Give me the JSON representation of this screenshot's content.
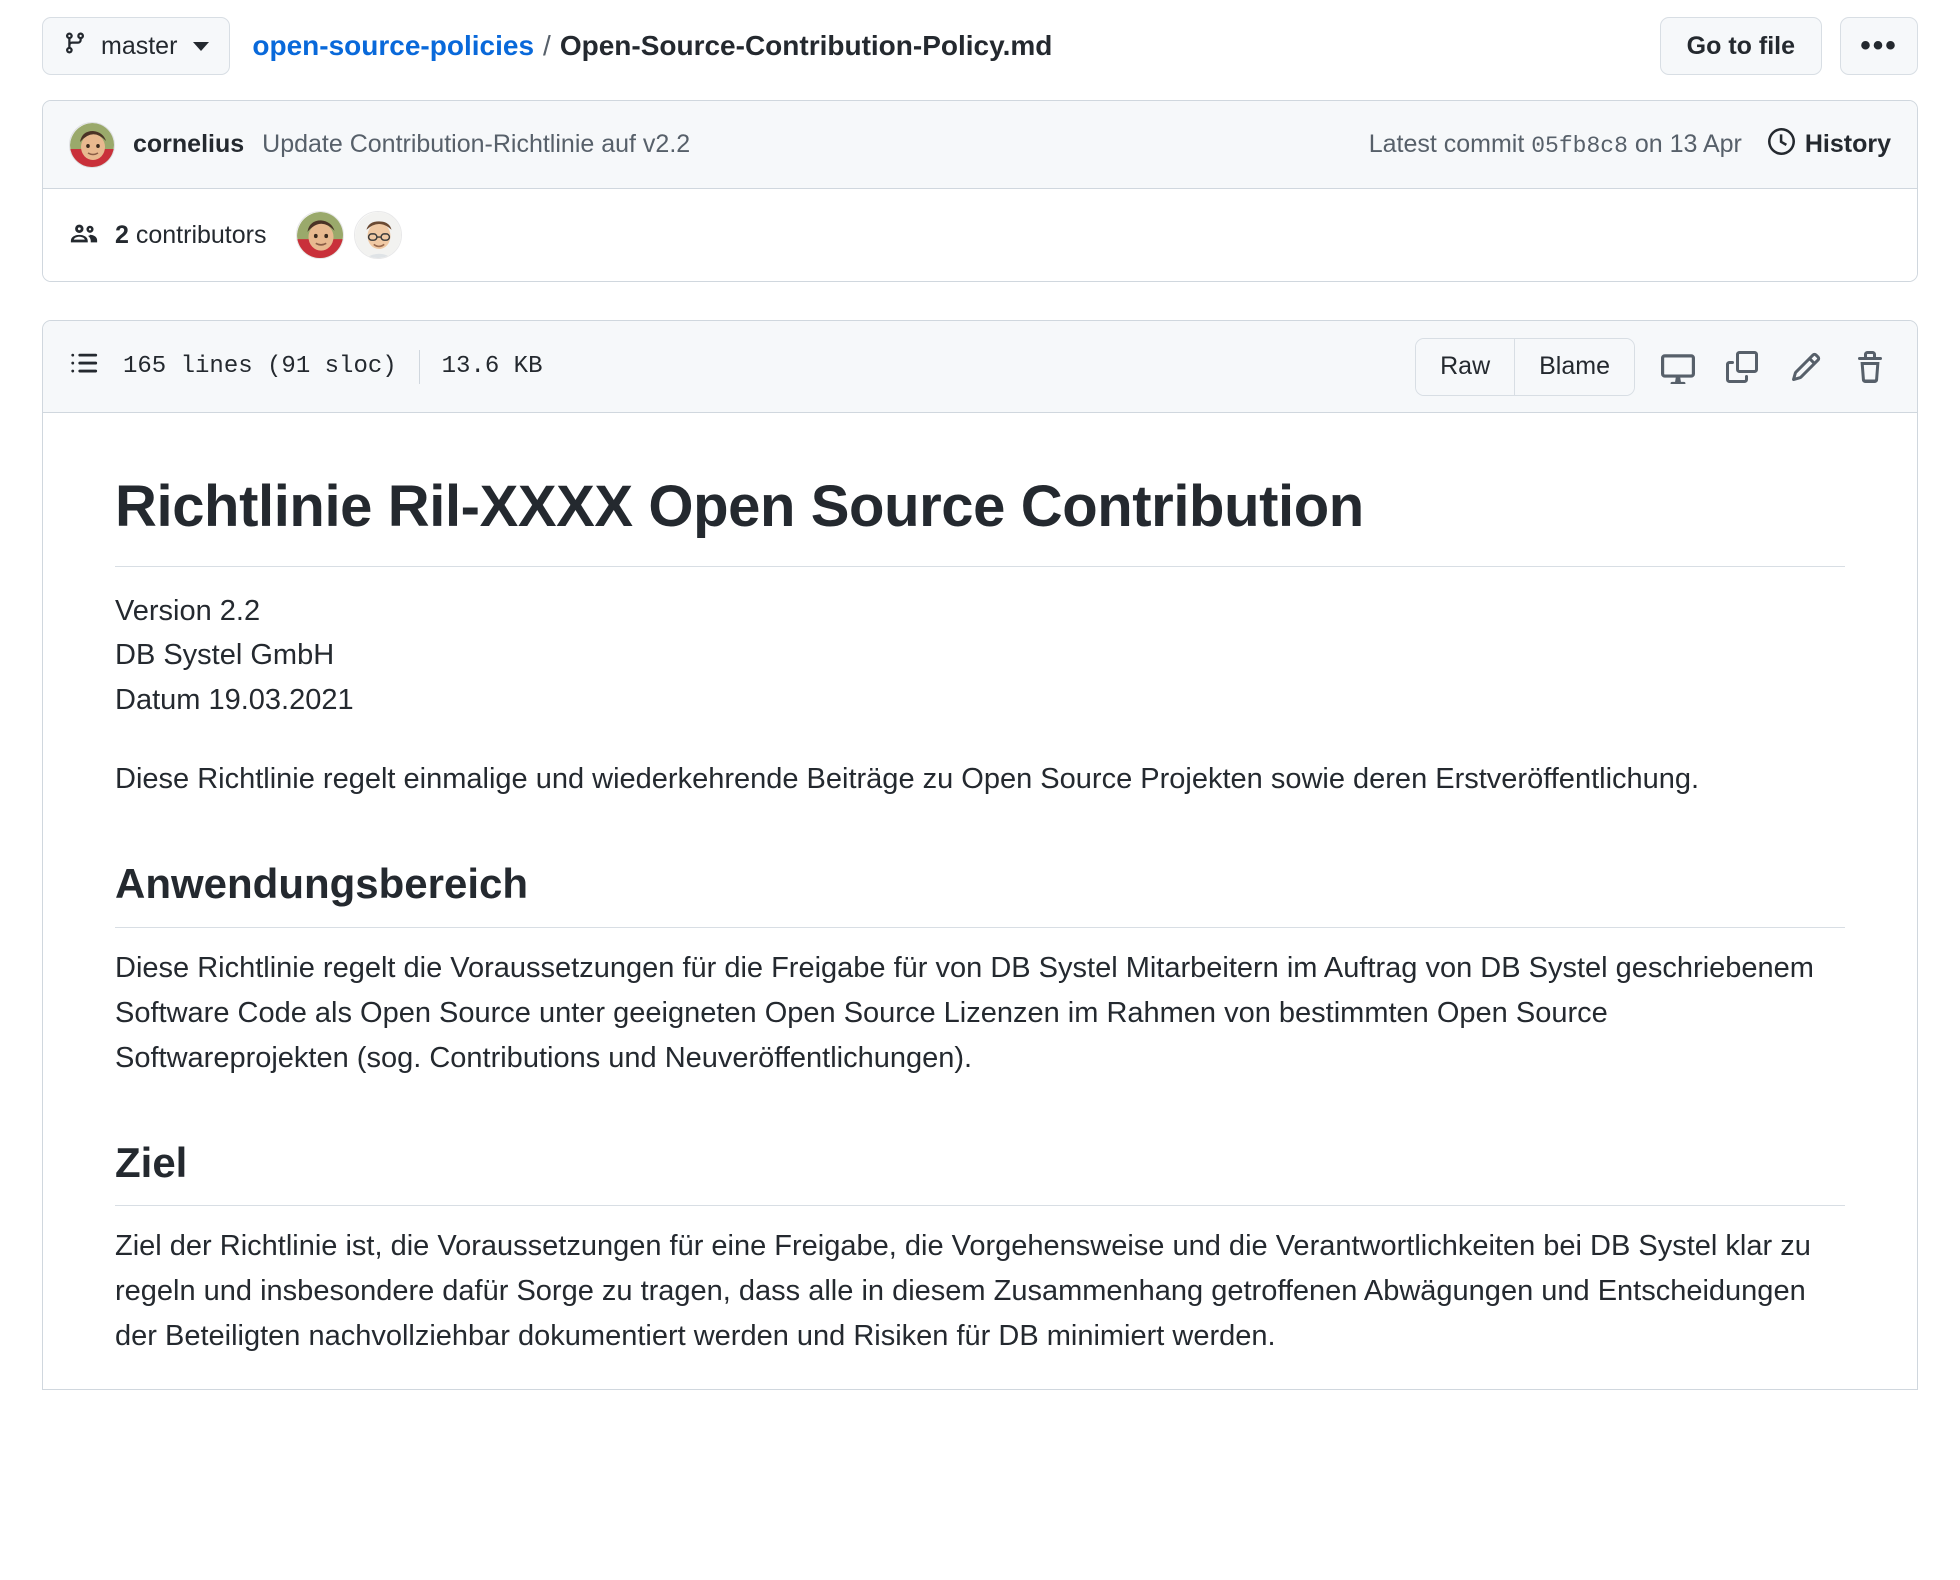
{
  "topbar": {
    "branch": "master",
    "branch_icon": "git-branch-icon",
    "caret_icon": "chevron-down-icon",
    "breadcrumb": {
      "repo": "open-source-policies",
      "separator": "/",
      "filename": "Open-Source-Contribution-Policy.md"
    },
    "go_to_file_label": "Go to file",
    "more_label": "•••"
  },
  "commit": {
    "author": "cornelius",
    "message": "Update Contribution-Richtlinie auf v2.2",
    "latest_commit_label": "Latest commit",
    "sha": "05fb8c8",
    "date": "on 13 Apr",
    "history_label": "History",
    "history_icon": "clock-history-icon"
  },
  "contributors": {
    "icon": "people-icon",
    "count": "2",
    "label": "contributors"
  },
  "file": {
    "list_icon": "list-unordered-icon",
    "lines": "165 lines (91 sloc)",
    "size": "13.6 KB",
    "raw_label": "Raw",
    "blame_label": "Blame",
    "actions": {
      "open_desktop": "desktop-download-icon",
      "copy": "copy-icon",
      "edit": "pencil-icon",
      "delete": "trash-icon"
    }
  },
  "document": {
    "title": "Richtlinie Ril-XXXX Open Source Contribution",
    "meta_lines": [
      "Version 2.2",
      "DB Systel GmbH",
      "Datum 19.03.2021"
    ],
    "intro": "Diese Richtlinie regelt einmalige und wiederkehrende Beiträge zu Open Source Projekten sowie deren Erstveröffentlichung.",
    "sections": [
      {
        "heading": "Anwendungsbereich",
        "body": "Diese Richtlinie regelt die Voraussetzungen für die Freigabe für von DB Systel Mitarbeitern im Auftrag von DB Systel geschriebenem Software Code als Open Source unter geeigneten Open Source Lizenzen im Rahmen von bestimmten Open Source Softwareprojekten (sog. Contributions und Neuveröffentlichungen)."
      },
      {
        "heading": "Ziel",
        "body": "Ziel der Richtlinie ist, die Voraussetzungen für eine Freigabe, die Vorgehensweise und die Verantwortlichkeiten bei DB Systel klar zu regeln und insbesondere dafür Sorge zu tragen, dass alle in diesem Zusammenhang getroffenen Abwägungen und Entscheidungen der Beteiligten nachvollziehbar dokumentiert werden und Risiken für DB minimiert werden."
      }
    ]
  },
  "colors": {
    "link": "#0969da",
    "text": "#24292f",
    "muted": "#57606a",
    "border": "#d0d7de",
    "surface": "#f6f8fa"
  }
}
